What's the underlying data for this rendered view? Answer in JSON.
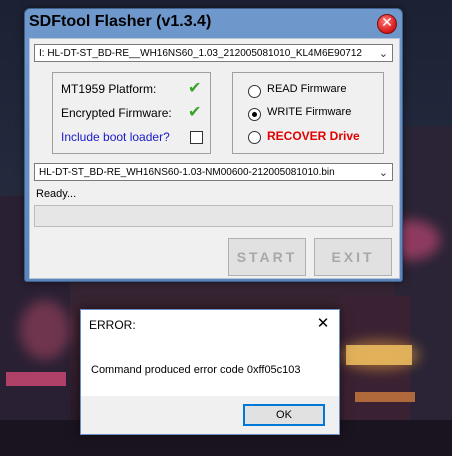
{
  "window": {
    "title": "SDFtool Flasher (v1.3.4)",
    "close_glyph": "✕"
  },
  "drive_select": {
    "value": "I:  HL-DT-ST_BD-RE__WH16NS60_1.03_212005081010_KL4M6E90712",
    "chevron": "⌄"
  },
  "info": {
    "platform_label": "MT1959 Platform:",
    "encrypted_label": "Encrypted Firmware:",
    "bootloader_label": "Include boot loader?",
    "check_glyph": "✔",
    "platform_checked": true,
    "encrypted_checked": true,
    "bootloader_checked": false
  },
  "actions": {
    "read_label": "READ Firmware",
    "write_label": "WRITE Firmware",
    "recover_label": "RECOVER Drive",
    "selected": "write"
  },
  "firmware_select": {
    "value": "HL-DT-ST_BD-RE_WH16NS60-1.03-NM00600-212005081010.bin",
    "chevron": "⌄"
  },
  "status": {
    "text": "Ready...",
    "progress": 0
  },
  "buttons": {
    "start_label": "START",
    "exit_label": "EXIT"
  },
  "error_dialog": {
    "title": "ERROR:",
    "close_glyph": "✕",
    "message": "Command produced error code 0xff05c103",
    "ok_label": "OK"
  },
  "colors": {
    "window_frame": "#6f98cc",
    "check_green": "#3aa42a",
    "recover_red": "#e00000",
    "bootloader_blue": "#1a1ac8",
    "dialog_accent": "#0078d7"
  },
  "icons": {
    "window_close": "close-circle-icon",
    "check": "checkmark-icon",
    "dropdown": "chevron-down-icon",
    "dialog_close": "close-icon"
  }
}
